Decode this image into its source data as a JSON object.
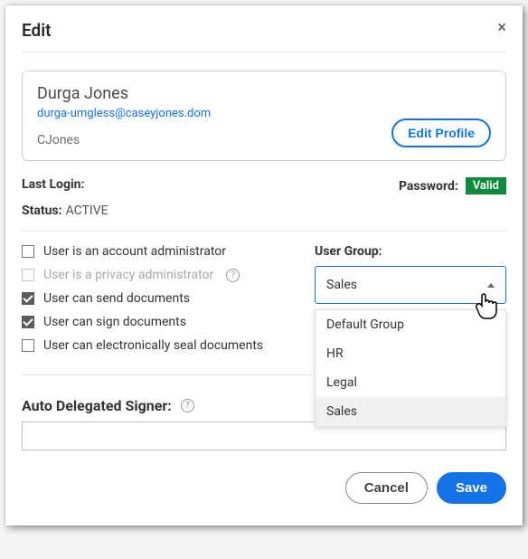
{
  "dialog": {
    "title": "Edit",
    "close": "×"
  },
  "profile": {
    "name": "Durga Jones",
    "email": "durga-umgless@caseyjones.dom",
    "username": "CJones",
    "editButton": "Edit Profile"
  },
  "login": {
    "lastLoginLabel": "Last Login:",
    "passwordLabel": "Password:",
    "passwordStatus": "Valid"
  },
  "status": {
    "label": "Status:",
    "value": "ACTIVE"
  },
  "permissions": {
    "accountAdmin": "User is an account administrator",
    "privacyAdmin": "User is a privacy administrator",
    "canSend": "User can send documents",
    "canSign": "User can sign documents",
    "canSeal": "User can electronically seal documents"
  },
  "userGroup": {
    "label": "User Group:",
    "selected": "Sales",
    "options": {
      "0": "Default Group",
      "1": "HR",
      "2": "Legal",
      "3": "Sales"
    }
  },
  "autoDelegate": {
    "label": "Auto Delegated Signer:",
    "value": ""
  },
  "footer": {
    "cancel": "Cancel",
    "save": "Save"
  }
}
